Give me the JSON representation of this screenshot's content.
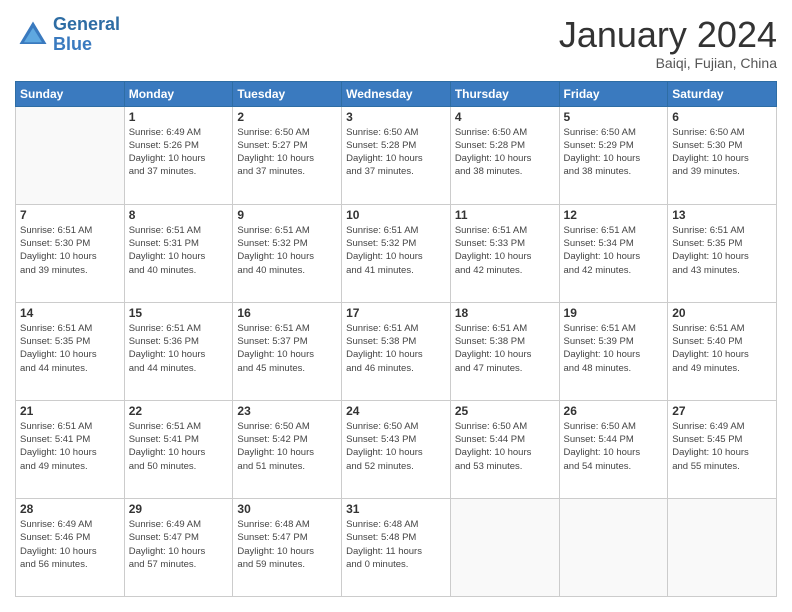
{
  "header": {
    "logo_line1": "General",
    "logo_line2": "Blue",
    "month_title": "January 2024",
    "subtitle": "Baiqi, Fujian, China"
  },
  "weekdays": [
    "Sunday",
    "Monday",
    "Tuesday",
    "Wednesday",
    "Thursday",
    "Friday",
    "Saturday"
  ],
  "weeks": [
    [
      {
        "day": "",
        "info": ""
      },
      {
        "day": "1",
        "info": "Sunrise: 6:49 AM\nSunset: 5:26 PM\nDaylight: 10 hours\nand 37 minutes."
      },
      {
        "day": "2",
        "info": "Sunrise: 6:50 AM\nSunset: 5:27 PM\nDaylight: 10 hours\nand 37 minutes."
      },
      {
        "day": "3",
        "info": "Sunrise: 6:50 AM\nSunset: 5:28 PM\nDaylight: 10 hours\nand 37 minutes."
      },
      {
        "day": "4",
        "info": "Sunrise: 6:50 AM\nSunset: 5:28 PM\nDaylight: 10 hours\nand 38 minutes."
      },
      {
        "day": "5",
        "info": "Sunrise: 6:50 AM\nSunset: 5:29 PM\nDaylight: 10 hours\nand 38 minutes."
      },
      {
        "day": "6",
        "info": "Sunrise: 6:50 AM\nSunset: 5:30 PM\nDaylight: 10 hours\nand 39 minutes."
      }
    ],
    [
      {
        "day": "7",
        "info": "Sunrise: 6:51 AM\nSunset: 5:30 PM\nDaylight: 10 hours\nand 39 minutes."
      },
      {
        "day": "8",
        "info": "Sunrise: 6:51 AM\nSunset: 5:31 PM\nDaylight: 10 hours\nand 40 minutes."
      },
      {
        "day": "9",
        "info": "Sunrise: 6:51 AM\nSunset: 5:32 PM\nDaylight: 10 hours\nand 40 minutes."
      },
      {
        "day": "10",
        "info": "Sunrise: 6:51 AM\nSunset: 5:32 PM\nDaylight: 10 hours\nand 41 minutes."
      },
      {
        "day": "11",
        "info": "Sunrise: 6:51 AM\nSunset: 5:33 PM\nDaylight: 10 hours\nand 42 minutes."
      },
      {
        "day": "12",
        "info": "Sunrise: 6:51 AM\nSunset: 5:34 PM\nDaylight: 10 hours\nand 42 minutes."
      },
      {
        "day": "13",
        "info": "Sunrise: 6:51 AM\nSunset: 5:35 PM\nDaylight: 10 hours\nand 43 minutes."
      }
    ],
    [
      {
        "day": "14",
        "info": "Sunrise: 6:51 AM\nSunset: 5:35 PM\nDaylight: 10 hours\nand 44 minutes."
      },
      {
        "day": "15",
        "info": "Sunrise: 6:51 AM\nSunset: 5:36 PM\nDaylight: 10 hours\nand 44 minutes."
      },
      {
        "day": "16",
        "info": "Sunrise: 6:51 AM\nSunset: 5:37 PM\nDaylight: 10 hours\nand 45 minutes."
      },
      {
        "day": "17",
        "info": "Sunrise: 6:51 AM\nSunset: 5:38 PM\nDaylight: 10 hours\nand 46 minutes."
      },
      {
        "day": "18",
        "info": "Sunrise: 6:51 AM\nSunset: 5:38 PM\nDaylight: 10 hours\nand 47 minutes."
      },
      {
        "day": "19",
        "info": "Sunrise: 6:51 AM\nSunset: 5:39 PM\nDaylight: 10 hours\nand 48 minutes."
      },
      {
        "day": "20",
        "info": "Sunrise: 6:51 AM\nSunset: 5:40 PM\nDaylight: 10 hours\nand 49 minutes."
      }
    ],
    [
      {
        "day": "21",
        "info": "Sunrise: 6:51 AM\nSunset: 5:41 PM\nDaylight: 10 hours\nand 49 minutes."
      },
      {
        "day": "22",
        "info": "Sunrise: 6:51 AM\nSunset: 5:41 PM\nDaylight: 10 hours\nand 50 minutes."
      },
      {
        "day": "23",
        "info": "Sunrise: 6:50 AM\nSunset: 5:42 PM\nDaylight: 10 hours\nand 51 minutes."
      },
      {
        "day": "24",
        "info": "Sunrise: 6:50 AM\nSunset: 5:43 PM\nDaylight: 10 hours\nand 52 minutes."
      },
      {
        "day": "25",
        "info": "Sunrise: 6:50 AM\nSunset: 5:44 PM\nDaylight: 10 hours\nand 53 minutes."
      },
      {
        "day": "26",
        "info": "Sunrise: 6:50 AM\nSunset: 5:44 PM\nDaylight: 10 hours\nand 54 minutes."
      },
      {
        "day": "27",
        "info": "Sunrise: 6:49 AM\nSunset: 5:45 PM\nDaylight: 10 hours\nand 55 minutes."
      }
    ],
    [
      {
        "day": "28",
        "info": "Sunrise: 6:49 AM\nSunset: 5:46 PM\nDaylight: 10 hours\nand 56 minutes."
      },
      {
        "day": "29",
        "info": "Sunrise: 6:49 AM\nSunset: 5:47 PM\nDaylight: 10 hours\nand 57 minutes."
      },
      {
        "day": "30",
        "info": "Sunrise: 6:48 AM\nSunset: 5:47 PM\nDaylight: 10 hours\nand 59 minutes."
      },
      {
        "day": "31",
        "info": "Sunrise: 6:48 AM\nSunset: 5:48 PM\nDaylight: 11 hours\nand 0 minutes."
      },
      {
        "day": "",
        "info": ""
      },
      {
        "day": "",
        "info": ""
      },
      {
        "day": "",
        "info": ""
      }
    ]
  ]
}
